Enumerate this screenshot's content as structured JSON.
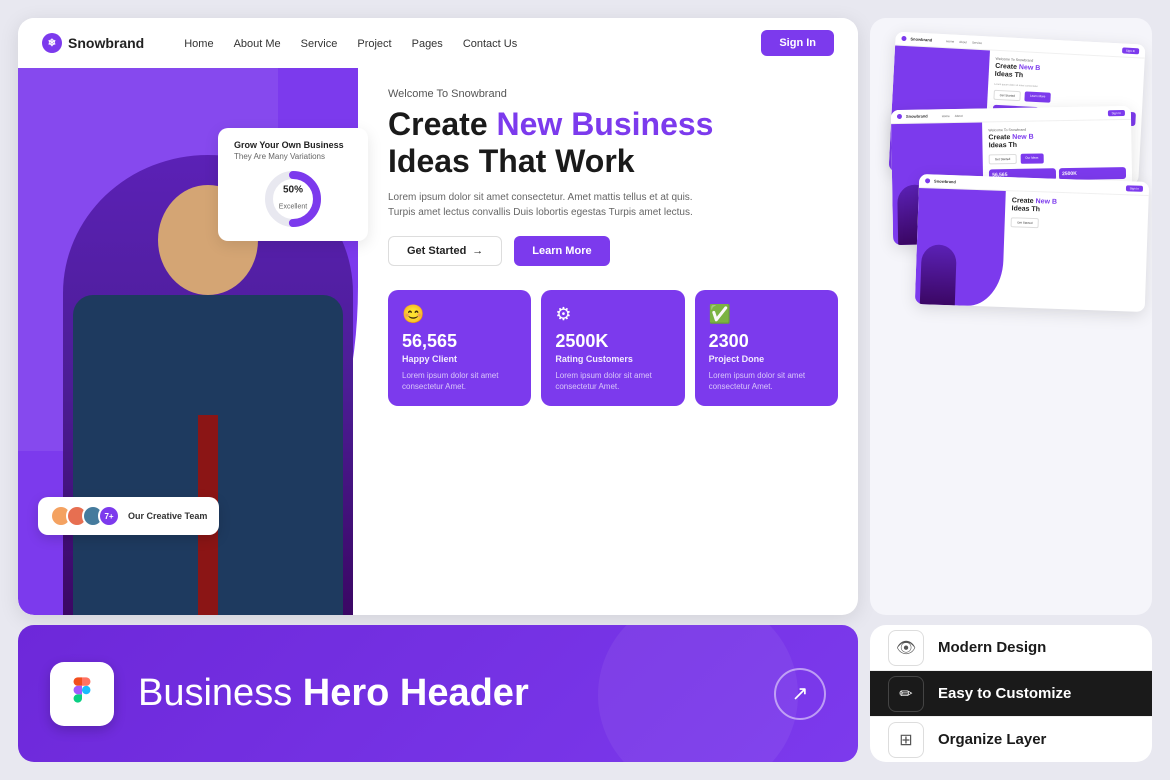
{
  "page": {
    "background": "#e8e8f0"
  },
  "navbar": {
    "logo_text": "Snowbrand",
    "links": [
      "Home",
      "About Me",
      "Service",
      "Project",
      "Pages",
      "Contact Us"
    ],
    "sign_in": "Sign In"
  },
  "hero": {
    "tagline": "Welcome To Snowbrand",
    "title_part1": "Create ",
    "title_highlight": "New Business",
    "title_part2": "Ideas That Work",
    "description": "Lorem ipsum dolor sit amet consectetur. Amet mattis tellus et at quis.\nTurpis amet lectus convallis Duis lobortis egestas Turpis amet lectus.",
    "btn_primary": "Get Started",
    "btn_secondary": "Learn More",
    "stat_card": {
      "title": "Grow Your Own Business",
      "subtitle": "They Are Many Variations",
      "percent": "50%",
      "label": "Excellent"
    },
    "team": {
      "count": "7+",
      "label": "Our Creative Team"
    },
    "stats": [
      {
        "icon": "😊",
        "number": "56,565",
        "label": "Happy Client",
        "desc": "Lorem ipsum dolor sit amet consectetur Amet."
      },
      {
        "icon": "⚙",
        "number": "2500K",
        "label": "Rating Customers",
        "desc": "Lorem ipsum dolor sit amet consectetur Amet."
      },
      {
        "icon": "✅",
        "number": "2300",
        "label": "Project Done",
        "desc": "Lorem ipsum dolor sit amet consectetur Amet."
      }
    ]
  },
  "bottom_banner": {
    "title_normal": "Business ",
    "title_bold": "Hero Header"
  },
  "features": [
    {
      "id": "modern-design",
      "icon": "👁",
      "label": "Modern Design",
      "active": false
    },
    {
      "id": "easy-customize",
      "icon": "✏",
      "label": "Easy to Customize",
      "active": true
    },
    {
      "id": "organize-layer",
      "icon": "⊞",
      "label": "Organize Layer",
      "active": false
    }
  ]
}
